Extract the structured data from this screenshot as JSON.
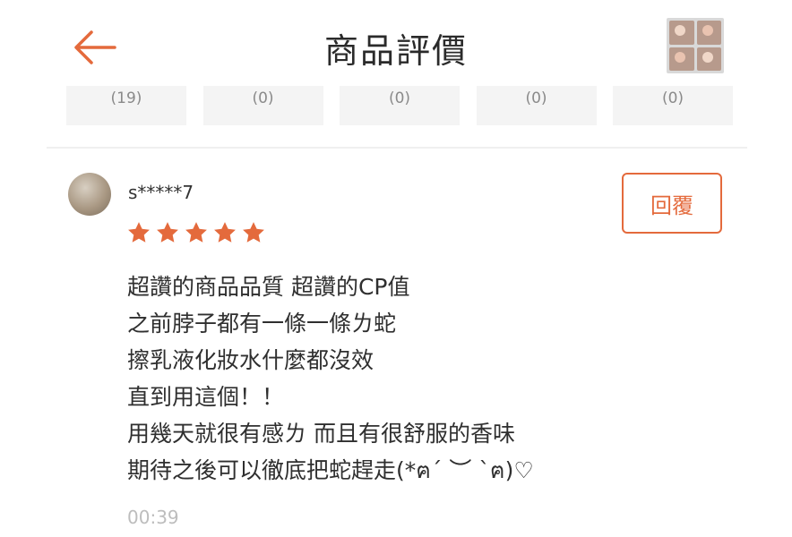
{
  "header": {
    "title": "商品評價"
  },
  "filters": [
    {
      "count": "(19)"
    },
    {
      "count": "(0)"
    },
    {
      "count": "(0)"
    },
    {
      "count": "(0)"
    },
    {
      "count": "(0)"
    }
  ],
  "review": {
    "username": "s*****7",
    "rating": 5,
    "reply_label": "回覆",
    "lines": [
      "超讚的商品品質 超讚的CP值",
      "之前脖子都有一條一條ㄌ蛇",
      "擦乳液化妝水什麼都沒效",
      "直到用這個！！",
      "用幾天就很有感ㄌ 而且有很舒服的香味",
      "期待之後可以徹底把蛇趕走(*ฅ´ ︶ `ฅ)♡"
    ],
    "time": "00:39"
  },
  "colors": {
    "accent": "#e46a3c"
  },
  "icons": {
    "back": "arrow-left-icon",
    "star": "star-icon"
  }
}
